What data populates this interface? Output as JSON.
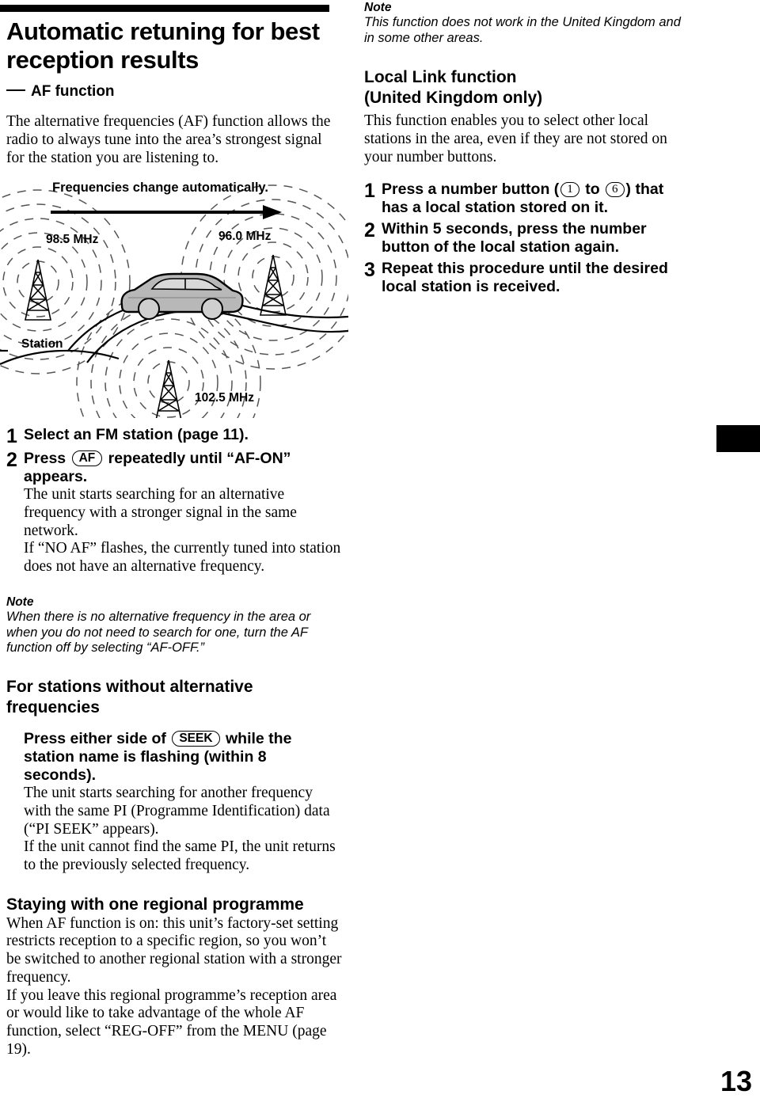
{
  "page": {
    "number": "13"
  },
  "left": {
    "title": "Automatic retuning for best reception results",
    "subhead": "AF function",
    "intro": "The alternative frequencies (AF) function allows the radio to always tune into the area’s strongest signal for the station you are listening to.",
    "diagram": {
      "caption": "Frequencies change automatically.",
      "station_label": "Station",
      "freq_left": "98.5 MHz",
      "freq_right": "96.0 MHz",
      "freq_bottom": "102.5 MHz"
    },
    "steps": [
      {
        "num": "1",
        "head_before": "Select an FM station (page 11).",
        "head_after": "",
        "keycap": "",
        "sub": ""
      },
      {
        "num": "2",
        "head_before": "Press",
        "keycap": "AF",
        "head_after": "repeatedly until “AF-ON” appears.",
        "sub": "The unit starts searching for an alternative frequency with a stronger signal in the same network.\nIf “NO AF” flashes, the currently tuned into station does not have an alternative frequency."
      }
    ],
    "note": {
      "label": "Note",
      "text": "When there is no alternative frequency in the area or when you do not need to search for one, turn the AF function off by selecting “AF-OFF.”"
    },
    "section_no_af": {
      "heading": "For stations without alternative frequencies",
      "instruction_before": "Press either side of",
      "keycap": "SEEK",
      "instruction_after": "while the station name is flashing (within 8 seconds).",
      "body": "The unit starts searching for another frequency with the same PI (Programme Identification) data (“PI SEEK” appears).\nIf the unit cannot find the same PI, the unit returns to the previously selected frequency."
    },
    "section_regional": {
      "heading": "Staying with one regional programme",
      "para1": "When AF function is on: this unit’s factory-set setting restricts reception to a specific region, so you won’t be switched to another regional station with a stronger frequency.",
      "para2": "If you leave this regional programme’s reception area or would like to take advantage of the whole AF function, select “REG-OFF” from the MENU (page 19)."
    }
  },
  "right": {
    "note": {
      "label": "Note",
      "text": "This function does not work in the United Kingdom and in some other areas."
    },
    "heading_line1": "Local Link function",
    "heading_line2": "(United Kingdom only)",
    "intro": "This function enables you to select other local stations in the area, even if they are not stored on your number buttons.",
    "steps": [
      {
        "num": "1",
        "part1": "Press a number button (",
        "key1": "1",
        "part2": "to",
        "key2": "6",
        "part3": ")",
        "part4": "that has a local station stored on it."
      },
      {
        "num": "2",
        "text": "Within 5 seconds, press the number button of the local station again."
      },
      {
        "num": "3",
        "text": "Repeat this procedure until the desired local station is received."
      }
    ]
  },
  "colors": {
    "ink": "#000000",
    "paper": "#ffffff",
    "wave": "#555555",
    "car_body": "#b8b8b8",
    "car_window": "#d4d4d4"
  }
}
